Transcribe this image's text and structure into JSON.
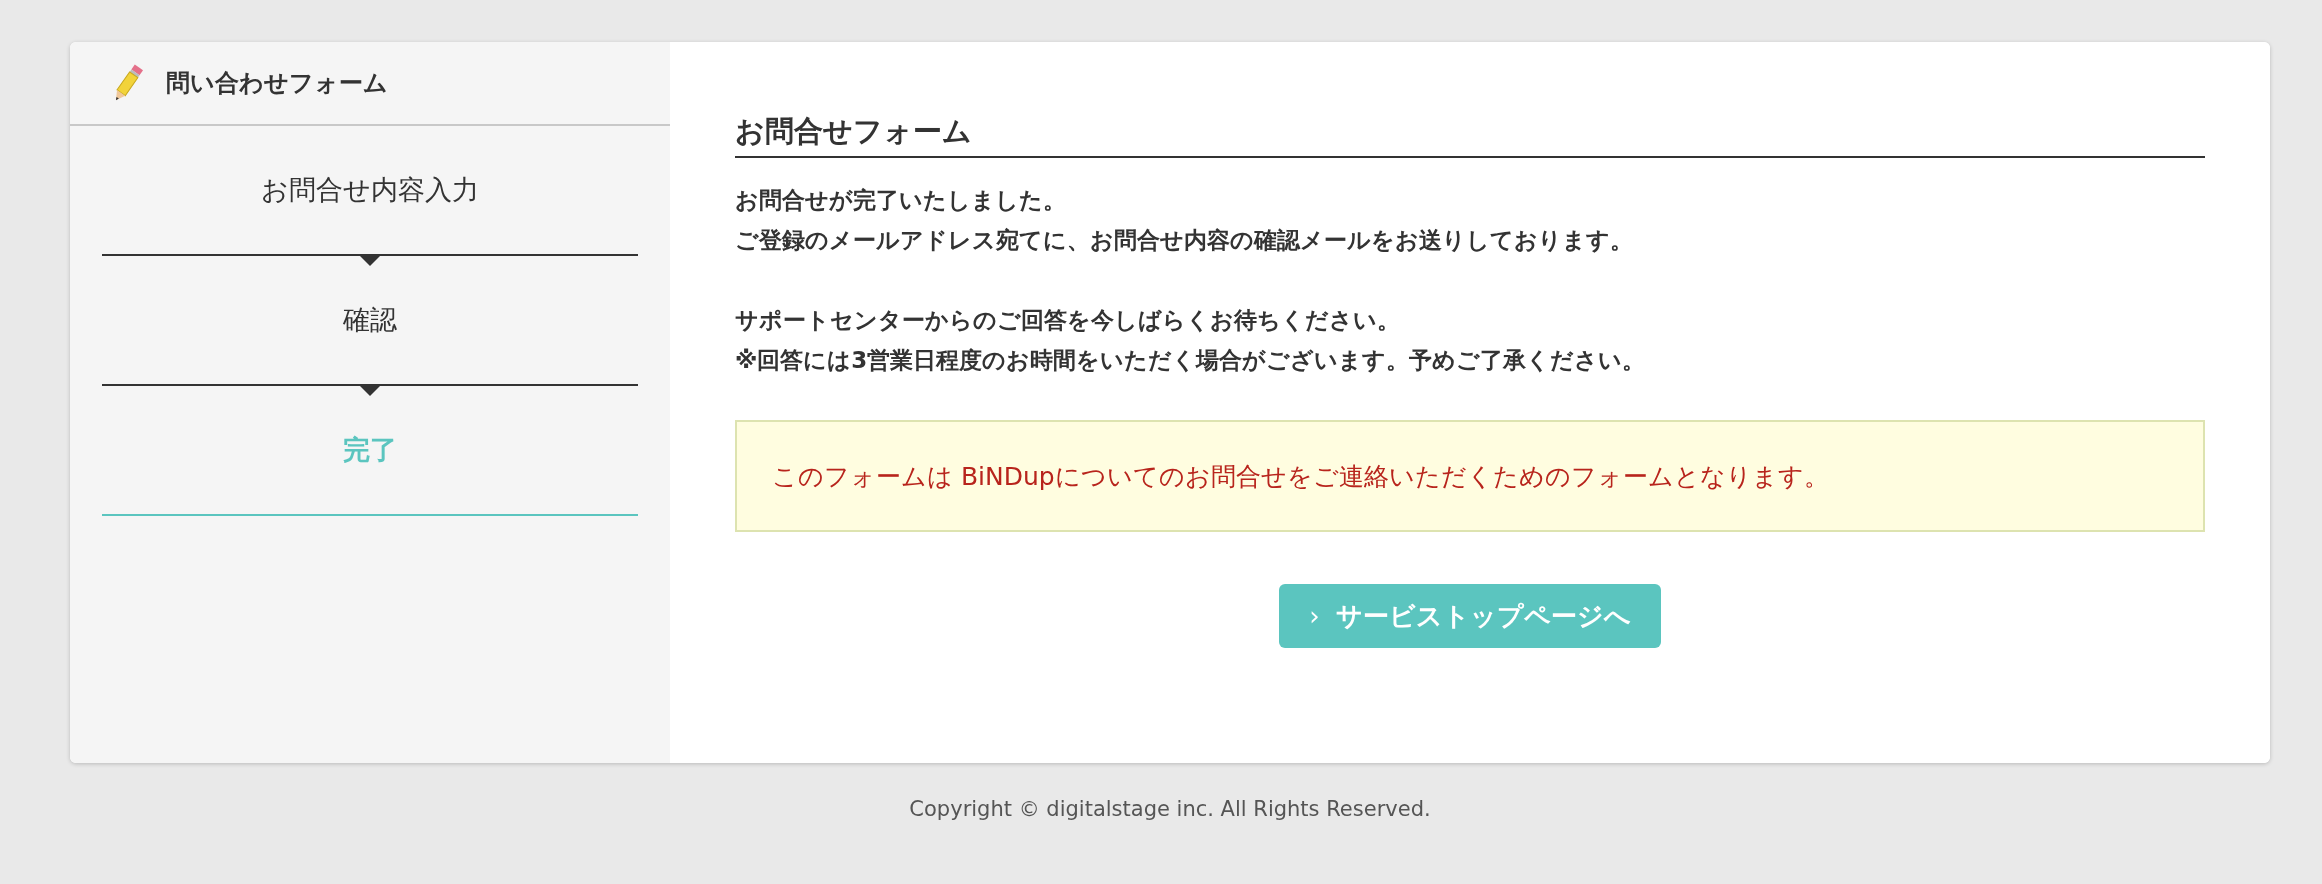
{
  "sidebar": {
    "title": "問い合わせフォーム",
    "steps": [
      {
        "label": "お問合せ内容入力",
        "selected": false
      },
      {
        "label": "確認",
        "selected": false
      },
      {
        "label": "完了",
        "selected": true
      }
    ]
  },
  "main": {
    "heading": "お問合せフォーム",
    "paragraphs": [
      [
        "お問合せが完了いたしました。",
        "ご登録のメールアドレス宛てに、お問合せ内容の確認メールをお送りしております。"
      ],
      [
        "サポートセンターからのご回答を今しばらくお待ちください。",
        "※回答には3営業日程度のお時間をいただく場合がございます。予めご了承ください。"
      ]
    ],
    "notice": "このフォームは BiNDupについてのお問合せをご連絡いただくためのフォームとなります。",
    "button": {
      "icon": "›",
      "label": "サービストップページへ"
    }
  },
  "footer": "Copyright © digitalstage inc. All Rights Reserved."
}
